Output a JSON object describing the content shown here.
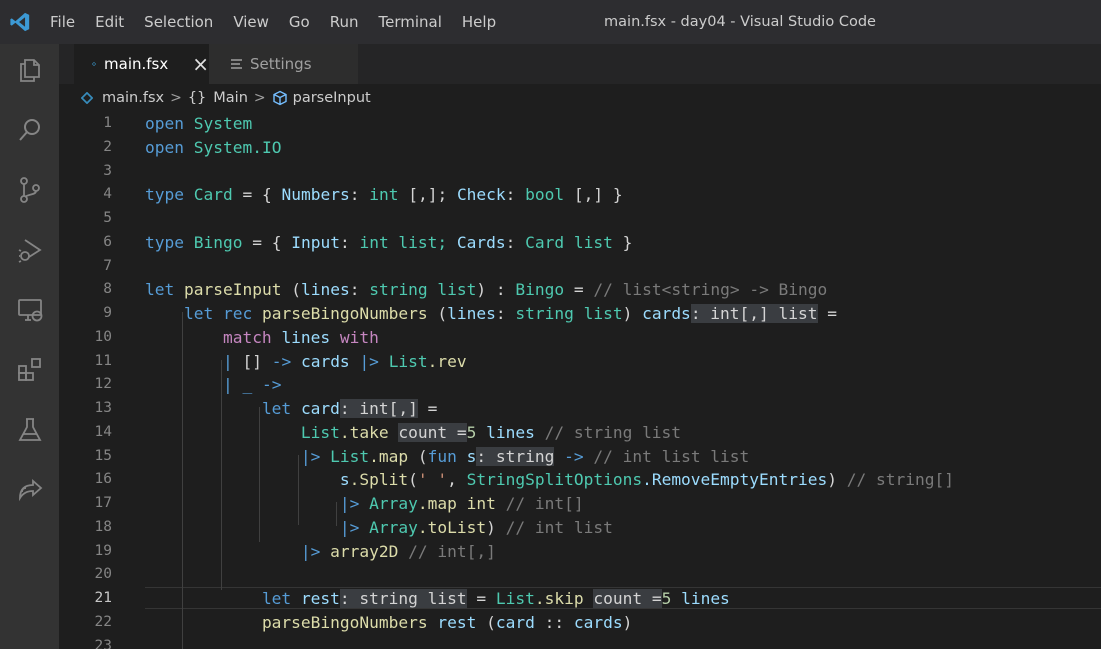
{
  "titlebar": {
    "menu": [
      "File",
      "Edit",
      "Selection",
      "View",
      "Go",
      "Run",
      "Terminal",
      "Help"
    ],
    "window_title": "main.fsx - day04 - Visual Studio Code"
  },
  "activity_bar": {
    "icons": [
      "explorer-icon",
      "search-icon",
      "source-control-icon",
      "run-debug-icon",
      "remote-explorer-icon",
      "extensions-icon",
      "testing-icon",
      "live-share-icon"
    ]
  },
  "tabs": [
    {
      "label": "main.fsx",
      "active": true,
      "close": "×"
    },
    {
      "label": "Settings",
      "active": false
    }
  ],
  "breadcrumb": {
    "file": "main.fsx",
    "namespace_icon": "{}",
    "namespace": "Main",
    "symbol": "parseInput",
    "separator": ">"
  },
  "editor": {
    "line_numbers": [
      "1",
      "2",
      "3",
      "4",
      "5",
      "6",
      "7",
      "8",
      "9",
      "10",
      "11",
      "12",
      "13",
      "14",
      "15",
      "16",
      "17",
      "18",
      "19",
      "20",
      "21",
      "22",
      "23"
    ],
    "current_line": 21,
    "tokens": {
      "l1": [
        "open",
        "System"
      ],
      "l2": [
        "open",
        "System.IO"
      ],
      "l4": [
        "type",
        "Card",
        "=",
        "{",
        "Numbers",
        ":",
        "int",
        "[,];",
        "Check",
        ":",
        "bool",
        "[,]",
        "}"
      ],
      "l6": [
        "type",
        "Bingo",
        "=",
        "{",
        "Input",
        ":",
        "int list;",
        "Cards",
        ":",
        "Card list",
        "}"
      ],
      "l8": [
        "let",
        "parseInput",
        "(",
        "lines",
        ":",
        "string list",
        ")",
        ":",
        "Bingo",
        "=",
        "// list<string> -> Bingo"
      ],
      "l9": [
        "let rec",
        "parseBingoNumbers",
        "(",
        "lines",
        ":",
        "string list",
        ")",
        "cards",
        ": int[,] list",
        "="
      ],
      "l10": [
        "match",
        "lines",
        "with"
      ],
      "l11": [
        "|",
        "[]",
        "->",
        "cards",
        "|>",
        "List",
        ".rev"
      ],
      "l12": [
        "|",
        "_",
        "->"
      ],
      "l13": [
        "let",
        "card",
        ": int[,]",
        "="
      ],
      "l14": [
        "List",
        ".take",
        "count =",
        "5",
        "lines",
        "// string list"
      ],
      "l15": [
        "|>",
        "List",
        ".map",
        "(",
        "fun",
        "s",
        ": string",
        "->",
        "// int list list"
      ],
      "l16": [
        "s",
        ".Split",
        "(",
        "' '",
        ",",
        "StringSplitOptions",
        ".RemoveEmptyEntries",
        ")",
        "// string[]"
      ],
      "l17": [
        "|>",
        "Array",
        ".map",
        "int",
        "// int[]"
      ],
      "l18": [
        "|>",
        "Array",
        ".toList",
        ")",
        "// int list"
      ],
      "l19": [
        "|>",
        "array2D",
        "// int[,]"
      ],
      "l21": [
        "let",
        "rest",
        ": string list",
        "=",
        "List",
        ".skip",
        "count =",
        "5",
        "lines"
      ],
      "l22": [
        "parseBingoNumbers",
        "rest",
        "(",
        "card",
        "::",
        "cards",
        ")"
      ]
    }
  }
}
